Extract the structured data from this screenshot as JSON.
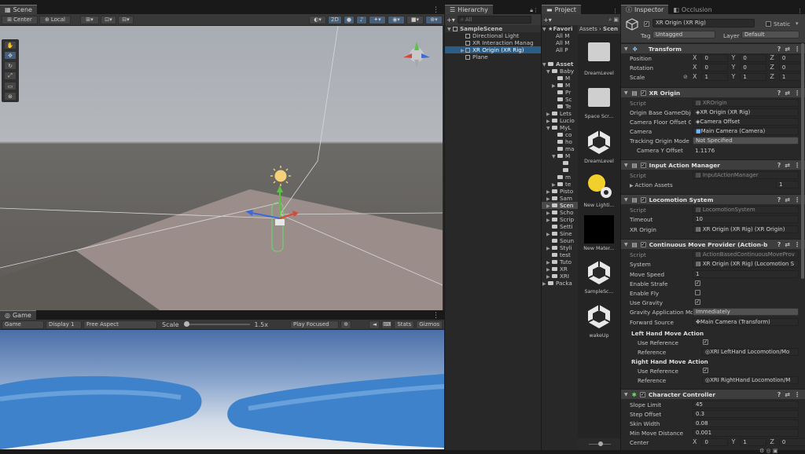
{
  "scene": {
    "tab": "Scene",
    "pivot": "Center",
    "space": "Local",
    "mode_2d": "2D"
  },
  "game": {
    "tab": "Game",
    "display_mode": "Game",
    "display": "Display 1",
    "aspect": "Free Aspect",
    "scale_label": "Scale",
    "scale_value": "1.5x",
    "play_mode": "Play Focused",
    "stats": "Stats",
    "gizmos": "Gizmos"
  },
  "hierarchy": {
    "tab": "Hierarchy",
    "search_placeholder": "All",
    "scene_name": "SampleScene",
    "items": [
      "Directional Light",
      "XR Interaction Manag",
      "XR Origin (XR Rig)",
      "Plane"
    ]
  },
  "project": {
    "tab": "Project",
    "breadcrumb_root": "Assets",
    "breadcrumb_child": "Scen",
    "favorites": "Favori",
    "fav_items": [
      "All M",
      "All M",
      "All P"
    ],
    "assets_root": "Asset",
    "tree": [
      "Baby",
      "M",
      "M",
      "Pr",
      "Sc",
      "Te",
      "Lets",
      "Lucio",
      "MyL",
      "co",
      "ho",
      "ma",
      "M",
      "m",
      "te",
      "Pisto",
      "Sam",
      "Scen",
      "Scho",
      "Scrip",
      "Setti",
      "Sine",
      "Soun",
      "Styli",
      "test",
      "Tuto",
      "XR",
      "XRI",
      "Packa"
    ],
    "tiles": [
      "DreamLevel",
      "Space Scr...",
      "DreamLevel",
      "New Lighti...",
      "New Mater...",
      "SampleSc...",
      "wakeUp"
    ]
  },
  "inspector": {
    "tab": "Inspector",
    "tab2": "Occlusion",
    "object_name": "XR Origin (XR Rig)",
    "static": "Static",
    "tag_label": "Tag",
    "tag_value": "Untagged",
    "layer_label": "Layer",
    "layer_value": "Default",
    "transform": {
      "title": "Transform",
      "position_label": "Position",
      "position": [
        "0",
        "0",
        "0"
      ],
      "rotation_label": "Rotation",
      "rotation": [
        "0",
        "0",
        "0"
      ],
      "scale_label": "Scale",
      "scale": [
        "1",
        "1",
        "1"
      ]
    },
    "xr_origin": {
      "title": "XR Origin",
      "script_label": "Script",
      "script_value": "XROrigin",
      "base_label": "Origin Base GameObje",
      "base_value": "XR Origin (XR Rig)",
      "offset_label": "Camera Floor Offset G",
      "offset_value": "Camera Offset",
      "camera_label": "Camera",
      "camera_value": "Main Camera (Camera)",
      "tracking_label": "Tracking Origin Mode",
      "tracking_value": "Not Specified",
      "y_offset_label": "Camera Y Offset",
      "y_offset_value": "1.1176"
    },
    "input_action": {
      "title": "Input Action Manager",
      "script_label": "Script",
      "script_value": "InputActionManager",
      "assets_label": "Action Assets",
      "assets_value": "1"
    },
    "locomotion": {
      "title": "Locomotion System",
      "script_label": "Script",
      "script_value": "LocomotionSystem",
      "timeout_label": "Timeout",
      "timeout_value": "10",
      "origin_label": "XR Origin",
      "origin_value": "XR Origin (XR Rig) (XR Origin)"
    },
    "move": {
      "title": "Continuous Move Provider (Action-based",
      "script_label": "Script",
      "script_value": "ActionBasedContinuousMoveProv",
      "system_label": "System",
      "system_value": "XR Origin (XR Rig) (Locomotion S",
      "speed_label": "Move Speed",
      "speed_value": "1",
      "strafe_label": "Enable Strafe",
      "fly_label": "Enable Fly",
      "gravity_label": "Use Gravity",
      "gravity_mode_label": "Gravity Application Mod",
      "gravity_mode_value": "Immediately",
      "forward_label": "Forward Source",
      "forward_value": "Main Camera (Transform)",
      "left_title": "Left Hand Move Action",
      "left_use_label": "Use Reference",
      "left_ref_label": "Reference",
      "left_ref_value": "XRI LeftHand Locomotion/Mo",
      "right_title": "Right Hand Move Action",
      "right_use_label": "Use Reference",
      "right_ref_label": "Reference",
      "right_ref_value": "XRI RightHand Locomotion/M"
    },
    "controller": {
      "title": "Character Controller",
      "slope_label": "Slope Limit",
      "slope_value": "45",
      "step_label": "Step Offset",
      "step_value": "0.3",
      "skin_label": "Skin Width",
      "skin_value": "0.08",
      "min_label": "Min Move Distance",
      "min_value": "0.001",
      "center_label": "Center",
      "center": [
        "0",
        "1",
        "0"
      ]
    }
  },
  "colors": {
    "selection": "#2c5d87",
    "panel": "#282828",
    "header": "#3e3e3e",
    "accent_x": "#d44a3a",
    "accent_y": "#5cc243",
    "accent_z": "#3c6bd6"
  }
}
